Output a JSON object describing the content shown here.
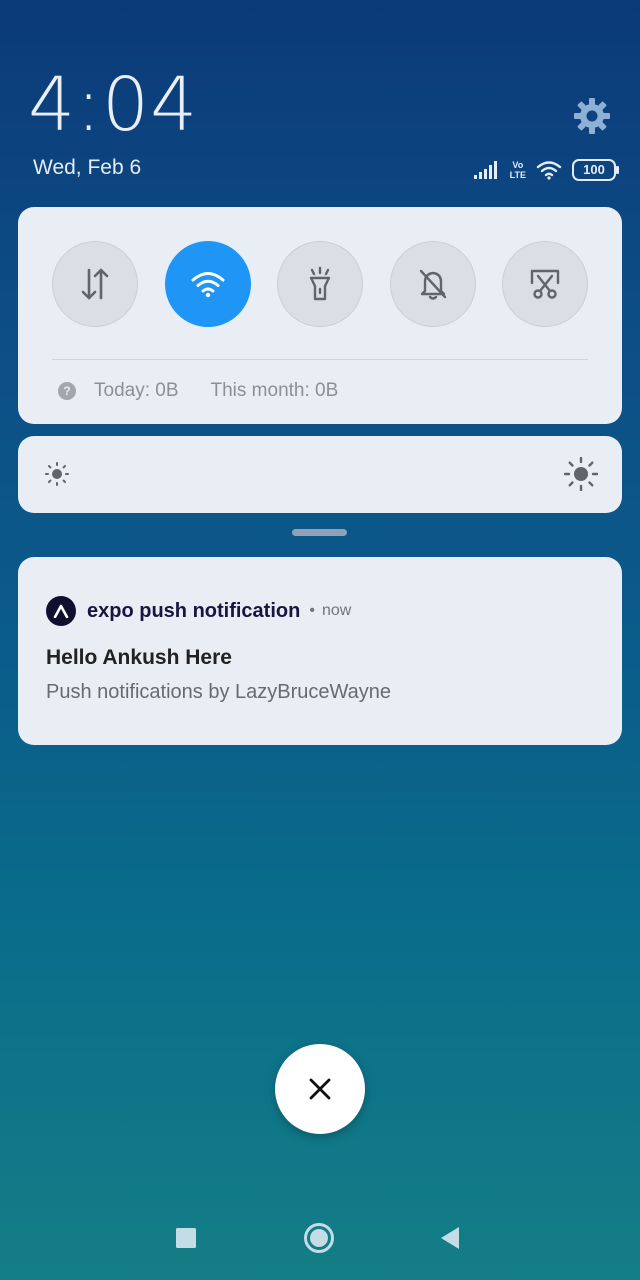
{
  "status_bar": {
    "time": "4:04",
    "date": "Wed, Feb 6",
    "volte_label_top": "Vo",
    "volte_label_bottom": "LTE",
    "battery": "100"
  },
  "quick_settings": {
    "toggles": [
      {
        "name": "mobile-data",
        "icon": "data-arrows-icon",
        "active": false
      },
      {
        "name": "wifi",
        "icon": "wifi-icon",
        "active": true
      },
      {
        "name": "flashlight",
        "icon": "flashlight-icon",
        "active": false
      },
      {
        "name": "silent",
        "icon": "bell-off-icon",
        "active": false
      },
      {
        "name": "screenshot",
        "icon": "scissors-icon",
        "active": false
      }
    ],
    "usage_today": "Today: 0B",
    "usage_month": "This month: 0B"
  },
  "notification": {
    "app_name": "expo push notification",
    "separator": "•",
    "time": "now",
    "title": "Hello Ankush Here",
    "body": "Push notifications by LazyBruceWayne"
  },
  "colors": {
    "accent": "#1f96f6",
    "panel": "#e8eef4",
    "background_top": "#0b3a78",
    "background_bottom": "#147e86"
  }
}
